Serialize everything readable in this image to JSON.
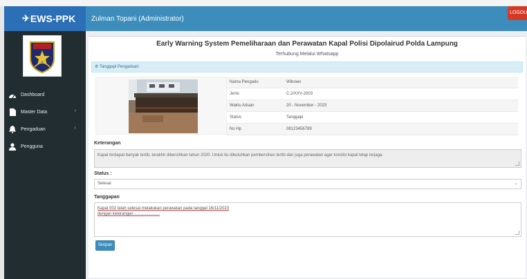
{
  "header": {
    "brand": "EWS-PPK",
    "user": "Zulman Topani (Administrator)",
    "logout_label": "LOGOUT"
  },
  "sidebar": {
    "items": [
      {
        "label": "Dashboard",
        "icon": "dashboard-icon"
      },
      {
        "label": "Master Data",
        "icon": "file-icon",
        "arrow": "‹"
      },
      {
        "label": "Pengaduan",
        "icon": "bell-icon",
        "arrow": "‹"
      },
      {
        "label": "Pengguna",
        "icon": "user-icon"
      }
    ]
  },
  "page": {
    "title": "Early Warning System Pemeliharaan dan Perawatan Kapal Polisi Dipolairud Polda Lampung",
    "subtitle": "Terhubung Melalui Whatsapp",
    "section_title": "Tanggapi Pengaduan"
  },
  "details": [
    {
      "label": "Nama Pengadu",
      "value": "Wibowo"
    },
    {
      "label": "Jenis",
      "value": "C.2/XXV-2003"
    },
    {
      "label": "Waktu Aduan",
      "value": "20 - November - 2023"
    },
    {
      "label": "Status",
      "value": "Tanggapi"
    },
    {
      "label": "No Hp",
      "value": "08123456789"
    }
  ],
  "keterangan": {
    "label": "Keterangan",
    "text": "Kapal terdapat banyak tertib, terakhir dibersihkan tahun 2020. Untuk itu dibutuhkan pembersihan tertib dan juga perawatan agar kondisi kapal tetap terjaga."
  },
  "status": {
    "label": "Status :",
    "selected": "Selesai"
  },
  "tanggapan": {
    "label": "Tanggapan",
    "line1": "Kapal 002 telah selesai melakukan perawatan pada tanggal 16/11/2023",
    "line2": "dengan keterangan ......................"
  },
  "save_label": "Simpan",
  "colors": {
    "brand": "#2b6fb6",
    "navbar": "#3c8dbc",
    "sidebar": "#222d32",
    "logout": "#d73925",
    "section_header": "#d9edf7"
  }
}
